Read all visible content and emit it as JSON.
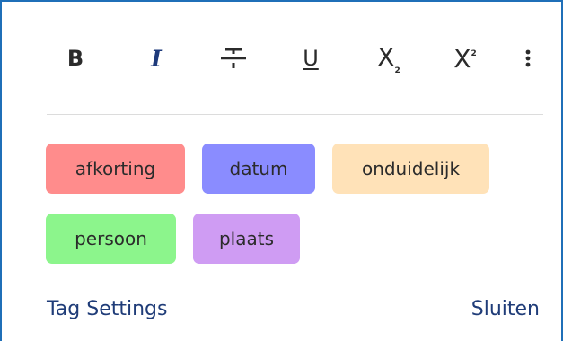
{
  "toolbar": {
    "bold_label": "B",
    "italic_label": "I",
    "underline_label": "U",
    "subscript_label": "X",
    "subscript_mark": "2",
    "superscript_label": "X",
    "superscript_mark": "2",
    "icons": [
      "bold-icon",
      "italic-icon",
      "strikethrough-icon",
      "underline-icon",
      "subscript-icon",
      "superscript-icon",
      "more-vertical-icon"
    ]
  },
  "tags": [
    {
      "label": "afkorting",
      "color": "#ff8c8c"
    },
    {
      "label": "datum",
      "color": "#8a8cff"
    },
    {
      "label": "onduidelijk",
      "color": "#ffe2b8"
    },
    {
      "label": "persoon",
      "color": "#8cf58c"
    },
    {
      "label": "plaats",
      "color": "#cf9cf3"
    }
  ],
  "footer": {
    "settings_label": "Tag Settings",
    "close_label": "Sluiten"
  },
  "colors": {
    "border": "#1f6fb8",
    "link": "#1f3c78",
    "divider": "#dcdcdc"
  }
}
